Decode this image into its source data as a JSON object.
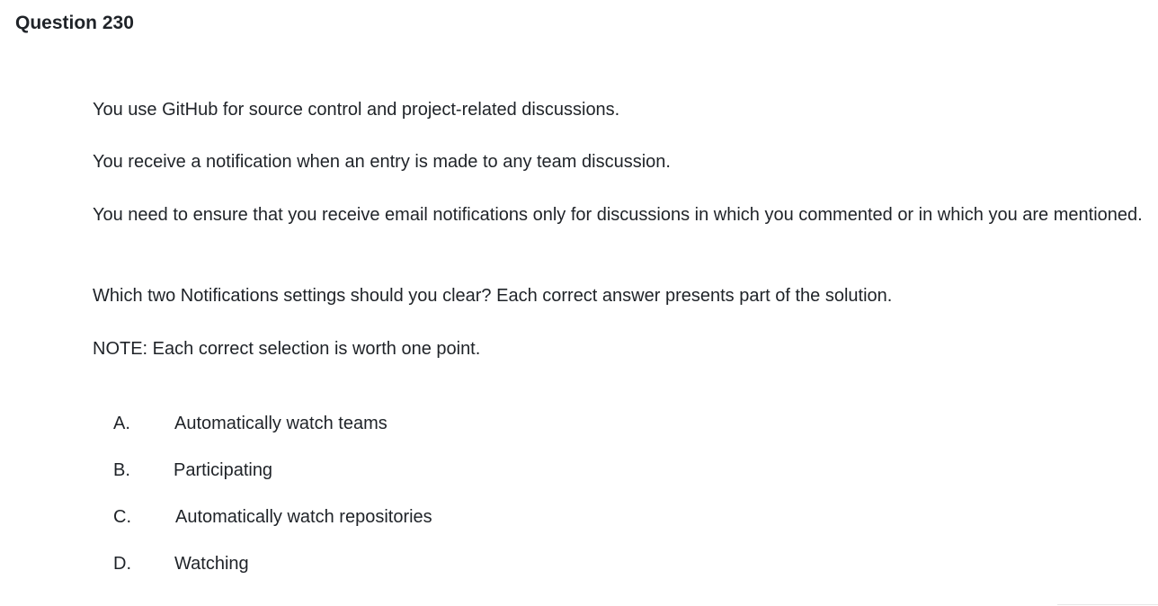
{
  "question": {
    "title": "Question 230",
    "paragraphs": [
      "You use GitHub for source control and project-related discussions.",
      "You receive a notification when an entry is made to any team discussion.",
      "You need to ensure that you receive email notifications only for discussions in which you commented or in which you are mentioned.",
      "Which two Notifications settings should you clear? Each correct answer presents part of the solution.",
      "NOTE: Each correct selection is worth one point."
    ],
    "options": [
      {
        "letter": "A.",
        "text": "Automatically watch teams"
      },
      {
        "letter": "B.",
        "text": "Participating"
      },
      {
        "letter": "C.",
        "text": "Automatically watch repositories"
      },
      {
        "letter": "D.",
        "text": "Watching"
      }
    ]
  }
}
